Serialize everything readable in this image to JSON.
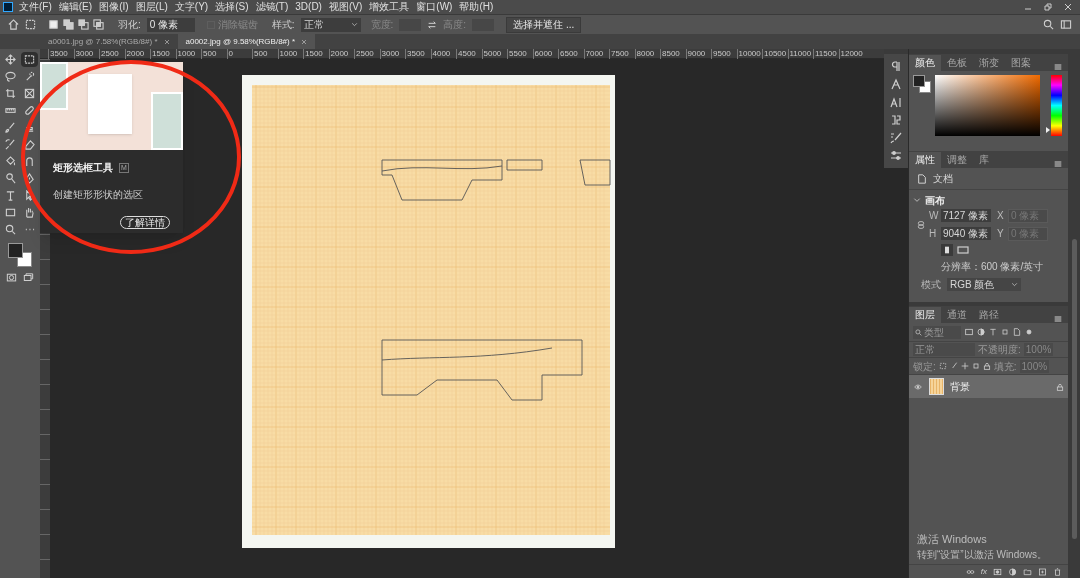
{
  "menu_bar": {
    "items": [
      "文件(F)",
      "编辑(E)",
      "图像(I)",
      "图层(L)",
      "文字(Y)",
      "选择(S)",
      "滤镜(T)",
      "3D(D)",
      "视图(V)",
      "增效工具",
      "窗口(W)",
      "帮助(H)"
    ]
  },
  "options_bar": {
    "feather_label": "羽化:",
    "feather_value": "0 像素",
    "anti_alias": {
      "label": "消除锯齿",
      "checked": false,
      "disabled": true
    },
    "style_label": "样式:",
    "style_value": "正常",
    "width_label": "宽度:",
    "height_label": "高度:",
    "select_mask_button": "选择并遮住 ..."
  },
  "tabs": [
    {
      "label": "a0001.jpg @ 7.58%(RGB/8#) *",
      "selected": false
    },
    {
      "label": "a0002.jpg @ 9.58%(RGB/8#) *",
      "selected": true
    }
  ],
  "ruler_labels": [
    "3500",
    "3000",
    "2500",
    "2000",
    "1500",
    "1000",
    "500",
    "0",
    "500",
    "1000",
    "1500",
    "2000",
    "2500",
    "3000",
    "3500",
    "4000",
    "4500",
    "5000",
    "5500",
    "6000",
    "6500",
    "7000",
    "7500",
    "8000",
    "8500",
    "9000",
    "9500",
    "10000",
    "10500",
    "11000",
    "11500",
    "12000"
  ],
  "tools": [
    {
      "kind": "move",
      "selected": false
    },
    {
      "kind": "marquee",
      "selected": true
    },
    {
      "kind": "lasso",
      "selected": false
    },
    {
      "kind": "quick-select",
      "selected": false
    },
    {
      "kind": "crop",
      "selected": false
    },
    {
      "kind": "frame",
      "selected": false
    },
    {
      "kind": "ruler",
      "selected": false
    },
    {
      "kind": "healing",
      "selected": false
    },
    {
      "kind": "brush",
      "selected": false
    },
    {
      "kind": "stamp",
      "selected": false
    },
    {
      "kind": "history-brush",
      "selected": false
    },
    {
      "kind": "eraser",
      "selected": false
    },
    {
      "kind": "bucket",
      "selected": false
    },
    {
      "kind": "smudge",
      "selected": false
    },
    {
      "kind": "dodge",
      "selected": false
    },
    {
      "kind": "pen",
      "selected": false
    },
    {
      "kind": "type",
      "selected": false
    },
    {
      "kind": "path-select",
      "selected": false
    },
    {
      "kind": "rectangle",
      "selected": false
    },
    {
      "kind": "hand",
      "selected": false
    },
    {
      "kind": "zoom",
      "selected": false
    },
    {
      "kind": "more",
      "selected": false
    }
  ],
  "tooltip": {
    "title": "矩形选框工具",
    "shortcut": "M",
    "description": "创建矩形形状的选区",
    "button": "了解详情"
  },
  "color_panel": {
    "hue_slider": {
      "level": 0.05
    },
    "tabs": [
      {
        "label": "颜色",
        "selected": true
      },
      {
        "label": "色板",
        "selected": false
      },
      {
        "label": "渐变",
        "selected": false
      },
      {
        "label": "图案",
        "selected": false
      }
    ]
  },
  "properties_panel": {
    "tabs": [
      {
        "label": "属性",
        "selected": true
      },
      {
        "label": "调整",
        "selected": false
      },
      {
        "label": "库",
        "selected": false
      }
    ],
    "type": "文档",
    "section": "画布",
    "expanded": true,
    "width_label": "W",
    "width": "7127 像素",
    "x_label": "X",
    "x": "0 像素",
    "height_label": "H",
    "height": "9040 像素",
    "y_label": "Y",
    "y": "0 像素",
    "resolution": "分辨率：600 像素/英寸",
    "mode_label": "模式",
    "mode": "RGB 颜色"
  },
  "layers_panel": {
    "tabs": [
      {
        "label": "图层",
        "selected": true
      },
      {
        "label": "通道",
        "selected": false
      },
      {
        "label": "路径",
        "selected": false
      }
    ],
    "filter_placeholder": "类型",
    "blend_mode": "正常",
    "opacity_label": "不透明度:",
    "opacity": "100%",
    "lock_label": "锁定:",
    "fill_label": "填充:",
    "fill": "100%",
    "layers": [
      {
        "name": "背景",
        "visible": true,
        "locked": true,
        "selected": true
      }
    ],
    "effects_button": "fx"
  },
  "windows_notice": {
    "title": "激活 Windows",
    "message": "转到“设置”以激活 Windows。"
  }
}
